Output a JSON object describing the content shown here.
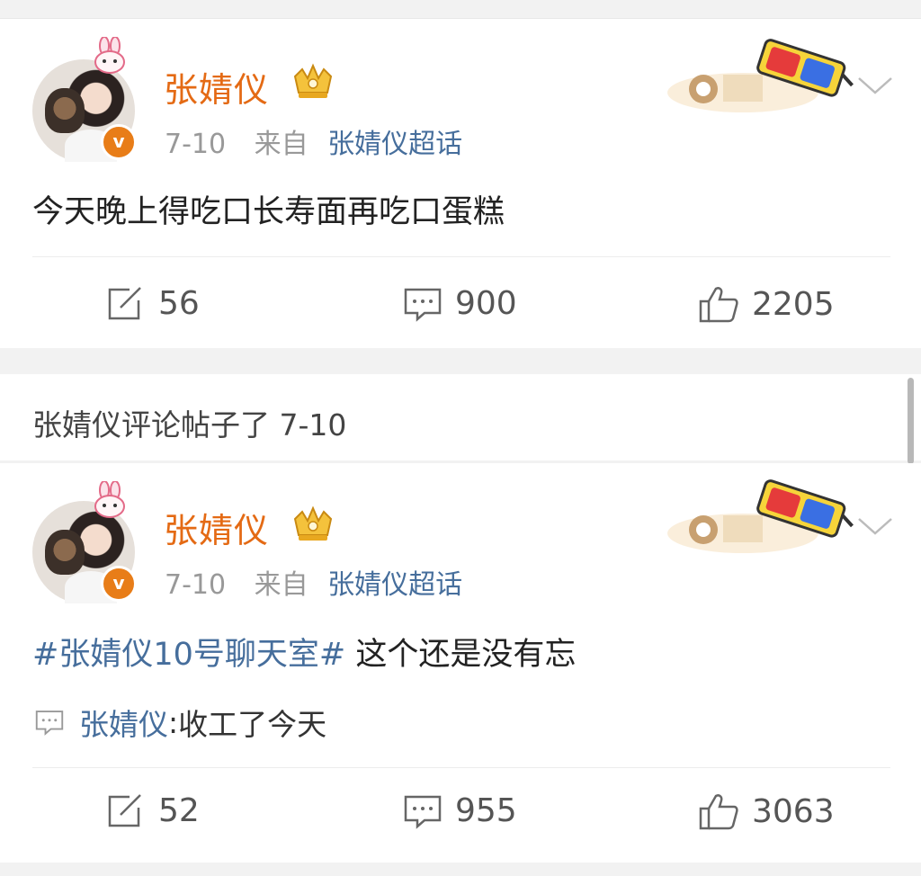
{
  "posts": [
    {
      "author": "张婧仪",
      "date": "7-10",
      "from_label": "来自",
      "source": "张婧仪超话",
      "content": "今天晚上得吃口长寿面再吃口蛋糕",
      "actions": {
        "repost": "56",
        "comment": "900",
        "like": "2205"
      },
      "icons": {
        "verified": "v-badge-icon",
        "crown": "crown-icon",
        "deco": "3d-glasses-sticker",
        "menu": "chevron-down-icon"
      }
    },
    {
      "author": "张婧仪",
      "date": "7-10",
      "from_label": "来自",
      "source": "张婧仪超话",
      "topic": "#张婧仪10号聊天室#",
      "content": " 这个还是没有忘",
      "reply": {
        "name": "张婧仪",
        "separator": ": ",
        "text": "收工了今天"
      },
      "actions": {
        "repost": "52",
        "comment": "955",
        "like": "3063"
      },
      "icons": {
        "verified": "v-badge-icon",
        "crown": "crown-icon",
        "deco": "3d-glasses-sticker",
        "menu": "chevron-down-icon"
      }
    }
  ],
  "repost_bar": {
    "text": "张婧仪评论帖子了 7-10"
  },
  "colors": {
    "author": "#e46a14",
    "link": "#466e9c",
    "meta": "#999999",
    "badge": "#e87d18",
    "background": "#f2f2f2"
  }
}
